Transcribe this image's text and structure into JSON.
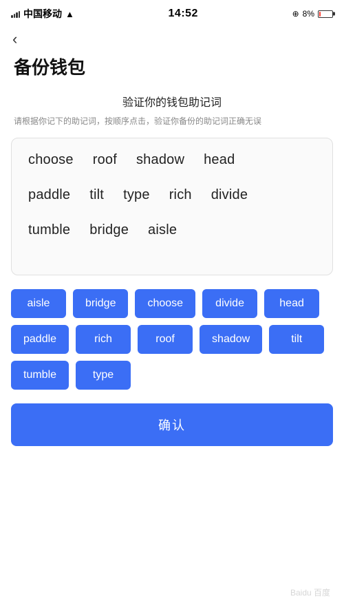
{
  "statusBar": {
    "carrier": "中国移动",
    "time": "14:52",
    "batteryPercent": "8%"
  },
  "back": "‹",
  "pageTitle": "备份钱包",
  "subtitle": {
    "main": "验证你的钱包助记词",
    "desc": "请根据你记下的助记词，按顺序点击，验证你备份的助记词正确无误"
  },
  "wordGridLines": [
    [
      "choose",
      "roof",
      "shadow",
      "head"
    ],
    [
      "paddle",
      "tilt",
      "type",
      "rich",
      "divide"
    ],
    [
      "tumble",
      "bridge",
      "aisle"
    ]
  ],
  "wordButtons": [
    "aisle",
    "bridge",
    "choose",
    "divide",
    "head",
    "paddle",
    "rich",
    "roof",
    "shadow",
    "tilt",
    "tumble",
    "type"
  ],
  "confirmButton": "确认"
}
